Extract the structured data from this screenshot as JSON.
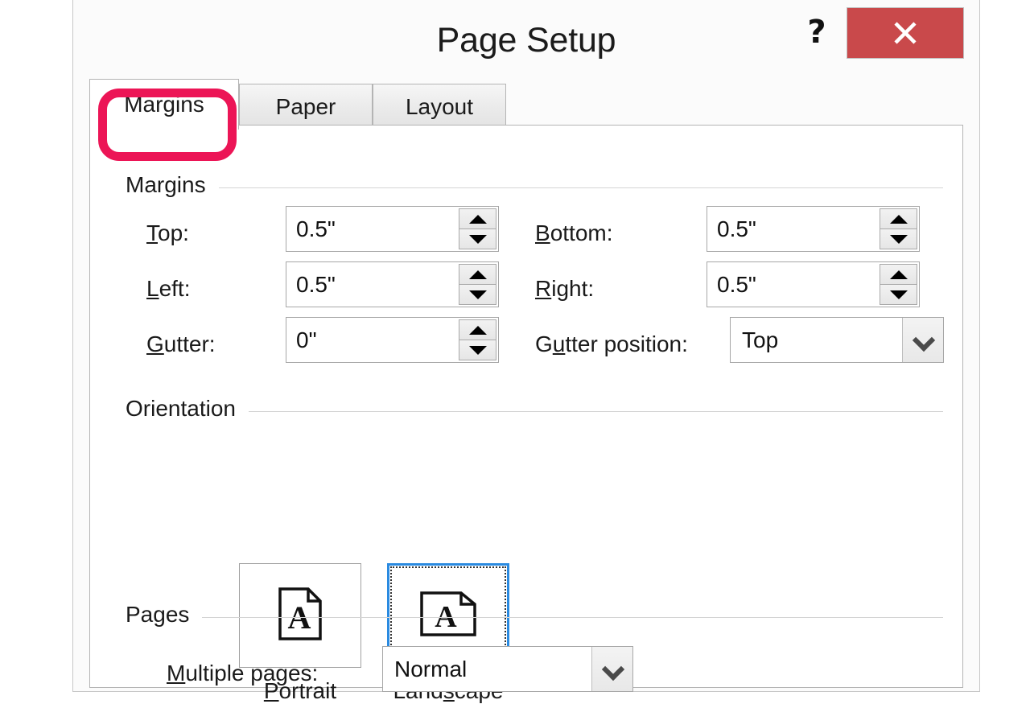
{
  "dialog": {
    "title": "Page Setup",
    "help_icon": "?",
    "close_icon": "close-x-icon",
    "accent_red": "#c9494b",
    "highlight_color": "#ec1556",
    "selection_color": "#2a8ae0"
  },
  "tabs": [
    {
      "label": "Margins",
      "active": true
    },
    {
      "label": "Paper",
      "active": false
    },
    {
      "label": "Layout",
      "active": false
    }
  ],
  "groups": {
    "margins": {
      "label": "Margins"
    },
    "orientation": {
      "label": "Orientation"
    },
    "pages": {
      "label": "Pages"
    }
  },
  "margins": {
    "top": {
      "label_accel": "T",
      "label_rest": "op:",
      "value": "0.5\""
    },
    "bottom": {
      "label_accel": "B",
      "label_rest": "ottom:",
      "value": "0.5\""
    },
    "left": {
      "label_accel": "L",
      "label_rest": "eft:",
      "value": "0.5\""
    },
    "right": {
      "label_accel": "R",
      "label_rest": "ight:",
      "value": "0.5\""
    },
    "gutter": {
      "label_accel": "G",
      "label_rest": "utter:",
      "value": "0\""
    },
    "gutter_position": {
      "label_pre": "G",
      "label_accel": "u",
      "label_rest": "tter position:",
      "value": "Top"
    }
  },
  "orientation": {
    "portrait": {
      "label_accel": "P",
      "label_pre": "",
      "label_rest": "ortrait",
      "selected": false,
      "icon": "page-portrait-icon"
    },
    "landscape": {
      "label_pre": "Land",
      "label_accel": "s",
      "label_rest": "cape",
      "selected": true,
      "icon": "page-landscape-icon"
    }
  },
  "pages": {
    "multiple_pages": {
      "label_accel": "M",
      "label_rest": "ultiple pages:",
      "value": "Normal"
    }
  }
}
